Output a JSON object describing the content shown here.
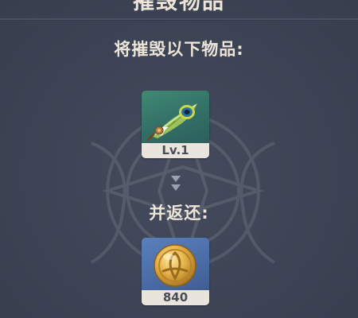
{
  "dialog": {
    "title": "摧毁物品",
    "destroy_label": "将摧毁以下物品:",
    "return_label": "并返还:"
  },
  "destroyed_item": {
    "icon": "peacock-feather-artifact-icon",
    "level": "Lv.1"
  },
  "returned_item": {
    "icon": "mora-coin-icon",
    "amount": "840"
  },
  "colors": {
    "background": "#3d4455",
    "text": "#ece5d8",
    "caption_bg": "#e9e5dc",
    "item_card": "#3f8a74",
    "reward_card": "#5a7fbc"
  }
}
